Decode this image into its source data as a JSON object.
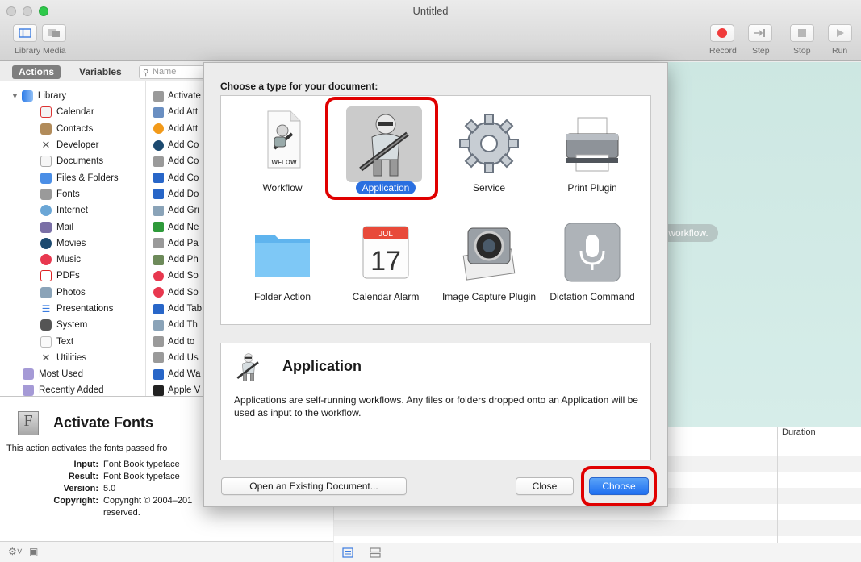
{
  "window": {
    "title": "Untitled"
  },
  "toolbar": {
    "library_label": "Library",
    "media_label": "Media",
    "record_label": "Record",
    "step_label": "Step",
    "stop_label": "Stop",
    "run_label": "Run"
  },
  "tabs": {
    "actions": "Actions",
    "variables": "Variables"
  },
  "search": {
    "placeholder": "Name"
  },
  "library": {
    "root": "Library",
    "items": [
      "Calendar",
      "Contacts",
      "Developer",
      "Documents",
      "Files & Folders",
      "Fonts",
      "Internet",
      "Mail",
      "Movies",
      "Music",
      "PDFs",
      "Photos",
      "Presentations",
      "System",
      "Text",
      "Utilities"
    ],
    "bottom": [
      "Most Used",
      "Recently Added"
    ]
  },
  "actions_list": [
    "Activate",
    "Add Att",
    "Add Att",
    "Add Co",
    "Add Co",
    "Add Co",
    "Add Do",
    "Add Gri",
    "Add Ne",
    "Add Pa",
    "Add Ph",
    "Add So",
    "Add So",
    "Add Tab",
    "Add Th",
    "Add to",
    "Add Us",
    "Add Wa",
    "Apple V"
  ],
  "description": {
    "title": "Activate Fonts",
    "text": "This action activates the fonts passed fro",
    "input_key": "Input:",
    "input_val": "Font Book typeface",
    "result_key": "Result:",
    "result_val": "Font Book typeface",
    "version_key": "Version:",
    "version_val": "5.0",
    "copyright_key": "Copyright:",
    "copyright_val": "Copyright © 2004–201",
    "copyright_val2": "reserved."
  },
  "workflow": {
    "hint": "r workflow."
  },
  "log": {
    "duration_header": "Duration"
  },
  "dialog": {
    "heading": "Choose a type for your document:",
    "types": [
      {
        "label": "Workflow"
      },
      {
        "label": "Application"
      },
      {
        "label": "Service"
      },
      {
        "label": "Print Plugin"
      },
      {
        "label": "Folder Action"
      },
      {
        "label": "Calendar Alarm"
      },
      {
        "label": "Image Capture Plugin"
      },
      {
        "label": "Dictation Command"
      }
    ],
    "wflow_badge": "WFLOW",
    "calendar_month": "JUL",
    "calendar_day": "17",
    "detail_title": "Application",
    "detail_text": "Applications are self-running workflows. Any files or folders dropped onto an Application will be used as input to the workflow.",
    "open_existing_label": "Open an Existing Document...",
    "close_label": "Close",
    "choose_label": "Choose"
  },
  "colors": {
    "accent": "#2a6fe0",
    "highlight": "#e00000",
    "workflow_bg": "#cde7e2"
  }
}
